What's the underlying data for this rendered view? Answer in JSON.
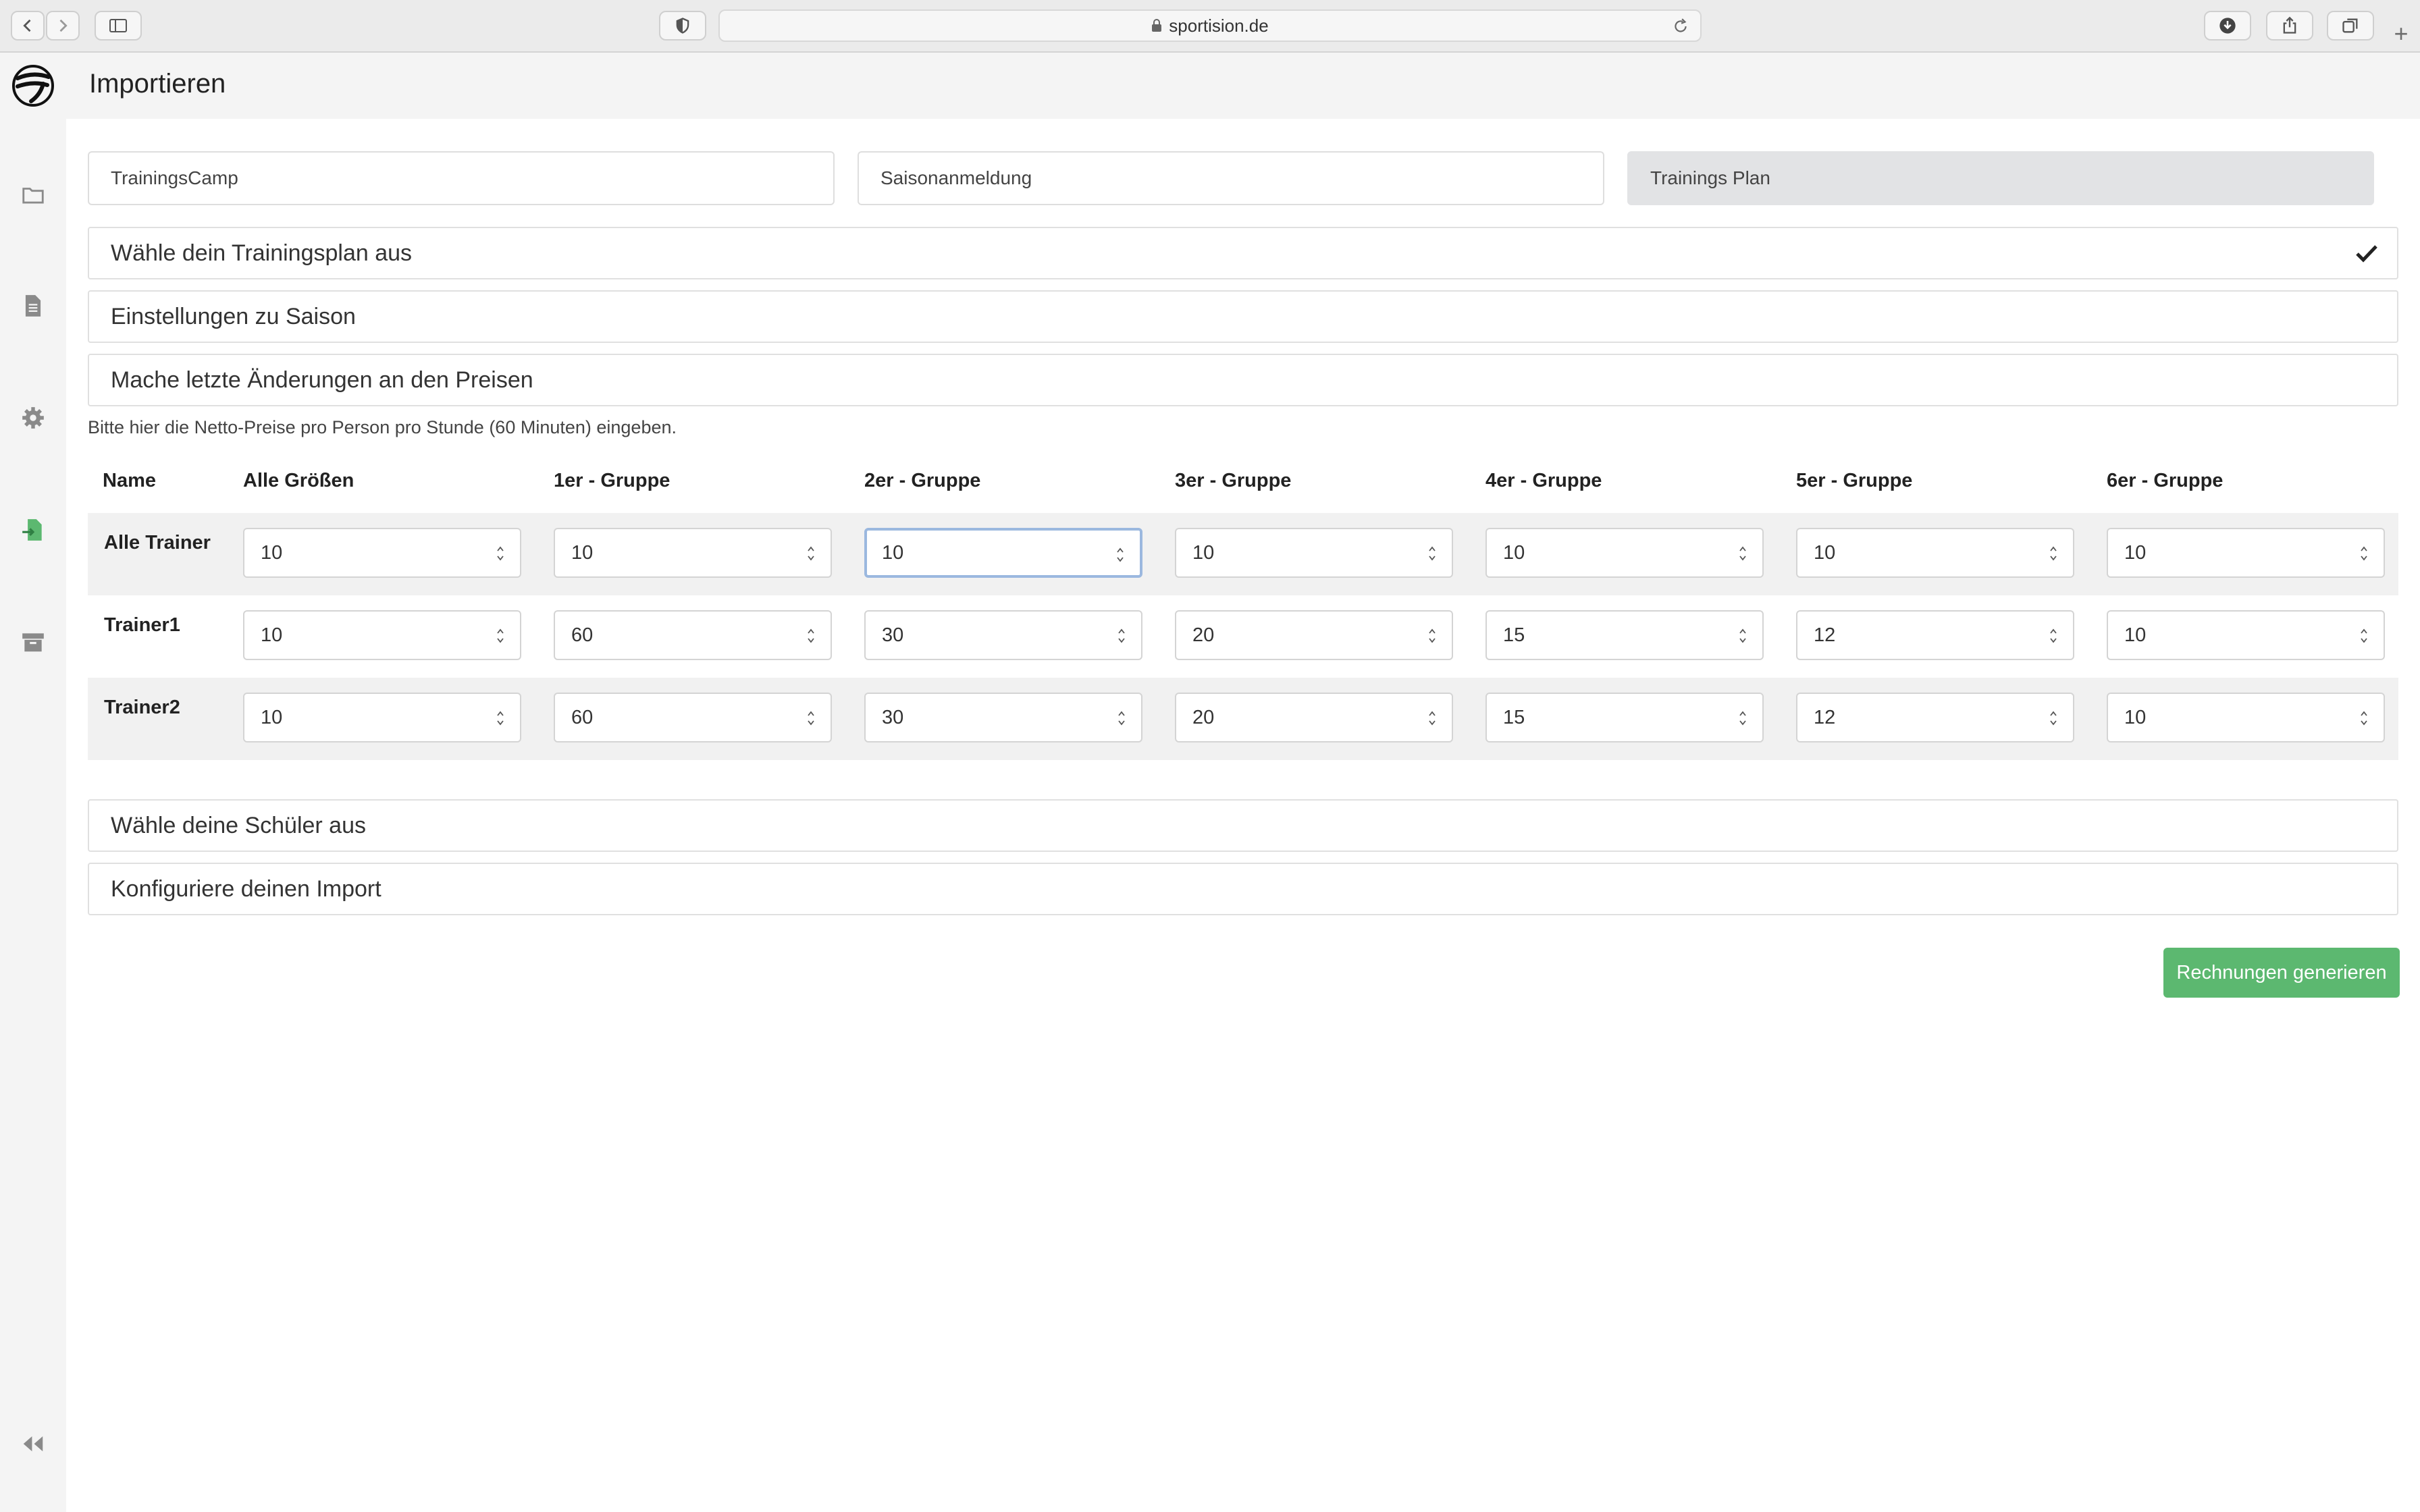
{
  "browser": {
    "url": "sportision.de"
  },
  "app": {
    "page_title": "Importieren"
  },
  "sidebar": {
    "items": [
      {
        "icon": "folder-icon"
      },
      {
        "icon": "document-icon"
      },
      {
        "icon": "gear-icon"
      },
      {
        "icon": "import-file-icon",
        "active": true,
        "color": "#5cb870"
      },
      {
        "icon": "archive-icon"
      }
    ],
    "collapse_icon": "collapse-double-chevron-icon"
  },
  "tabs": [
    {
      "label": "TrainingsCamp",
      "active": false
    },
    {
      "label": "Saisonanmeldung",
      "active": false
    },
    {
      "label": "Trainings Plan",
      "active": true
    }
  ],
  "sections": {
    "choose_plan": "Wähle dein Trainingsplan aus",
    "season_settings": "Einstellungen zu Saison",
    "price_changes": "Mache letzte Änderungen an den Preisen",
    "choose_students": "Wähle deine Schüler aus",
    "configure_import": "Konfiguriere deinen Import"
  },
  "price_hint": "Bitte hier die Netto-Preise pro Person pro Stunde (60 Minuten) eingeben.",
  "price_table": {
    "headers": [
      "Name",
      "Alle Größen",
      "1er - Gruppe",
      "2er - Gruppe",
      "3er - Gruppe",
      "4er - Gruppe",
      "5er - Gruppe",
      "6er - Gruppe"
    ],
    "rows": [
      {
        "name": "Alle Trainer",
        "values": [
          "10",
          "10",
          "10",
          "10",
          "10",
          "10",
          "10"
        ]
      },
      {
        "name": "Trainer1",
        "values": [
          "10",
          "60",
          "30",
          "20",
          "15",
          "12",
          "10"
        ]
      },
      {
        "name": "Trainer2",
        "values": [
          "10",
          "60",
          "30",
          "20",
          "15",
          "12",
          "10"
        ]
      }
    ]
  },
  "actions": {
    "generate_label": "Rechnungen generieren"
  },
  "colors": {
    "accent_green": "#5cb870",
    "active_tab": "#e2e3e5",
    "focus_ring": "#9bb8df"
  }
}
